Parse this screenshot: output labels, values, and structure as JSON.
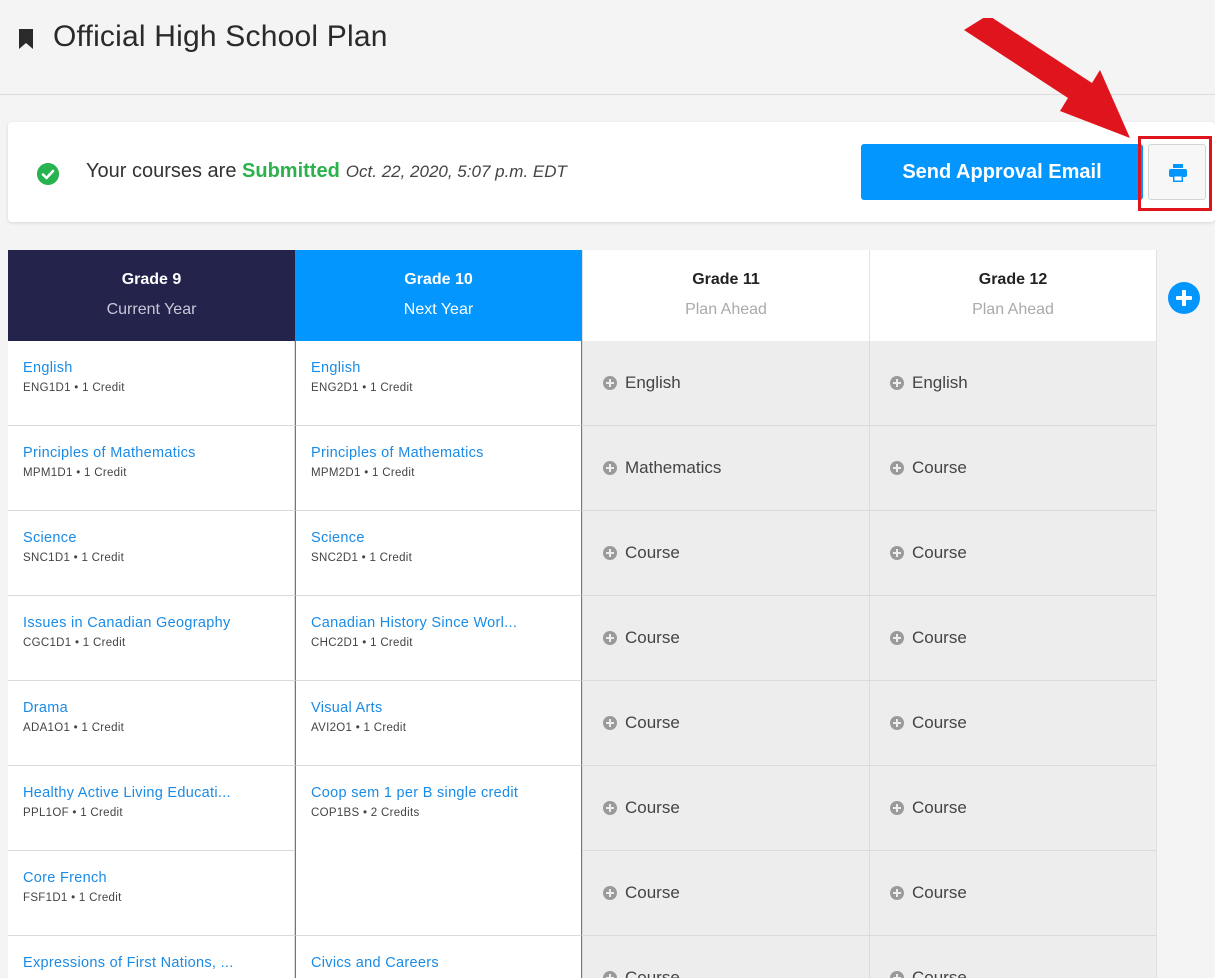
{
  "header": {
    "title": "Official High School Plan"
  },
  "status": {
    "prefix": "Your courses are ",
    "state": "Submitted",
    "timestamp": "Oct. 22, 2020, 5:07 p.m. EDT",
    "send_label": "Send Approval Email",
    "print_icon": "print-icon"
  },
  "colors": {
    "accent": "#0496ff",
    "current_year": "#23234b",
    "success": "#27b34f",
    "annotation": "#e0141c"
  },
  "columns": [
    {
      "grade": "Grade 9",
      "sub": "Current Year"
    },
    {
      "grade": "Grade 10",
      "sub": "Next Year"
    },
    {
      "grade": "Grade 11",
      "sub": "Plan Ahead"
    },
    {
      "grade": "Grade 12",
      "sub": "Plan Ahead"
    }
  ],
  "grade9": [
    {
      "name": "English",
      "code": "ENG1D1 • 1 Credit"
    },
    {
      "name": "Principles of Mathematics",
      "code": "MPM1D1 • 1 Credit"
    },
    {
      "name": "Science",
      "code": "SNC1D1 • 1 Credit"
    },
    {
      "name": "Issues in Canadian Geography",
      "code": "CGC1D1 • 1 Credit"
    },
    {
      "name": "Drama",
      "code": "ADA1O1 • 1 Credit"
    },
    {
      "name": "Healthy Active Living Educati...",
      "code": "PPL1OF • 1 Credit"
    },
    {
      "name": "Core French",
      "code": "FSF1D1 • 1 Credit"
    },
    {
      "name": "Expressions of First Nations, ...",
      "code": ""
    }
  ],
  "grade10": [
    {
      "name": "English",
      "code": "ENG2D1 • 1 Credit"
    },
    {
      "name": "Principles of Mathematics",
      "code": "MPM2D1 • 1 Credit"
    },
    {
      "name": "Science",
      "code": "SNC2D1 • 1 Credit"
    },
    {
      "name": "Canadian History Since Worl...",
      "code": "CHC2D1 • 1 Credit"
    },
    {
      "name": "Visual Arts",
      "code": "AVI2O1 • 1 Credit"
    },
    {
      "name": "Coop sem 1 per B single credit",
      "code": "COP1BS • 2 Credits"
    },
    {
      "name": "Civics and Careers",
      "code": ""
    }
  ],
  "grade11": [
    "English",
    "Mathematics",
    "Course",
    "Course",
    "Course",
    "Course",
    "Course",
    "Course"
  ],
  "grade12": [
    "English",
    "Course",
    "Course",
    "Course",
    "Course",
    "Course",
    "Course",
    "Course"
  ]
}
